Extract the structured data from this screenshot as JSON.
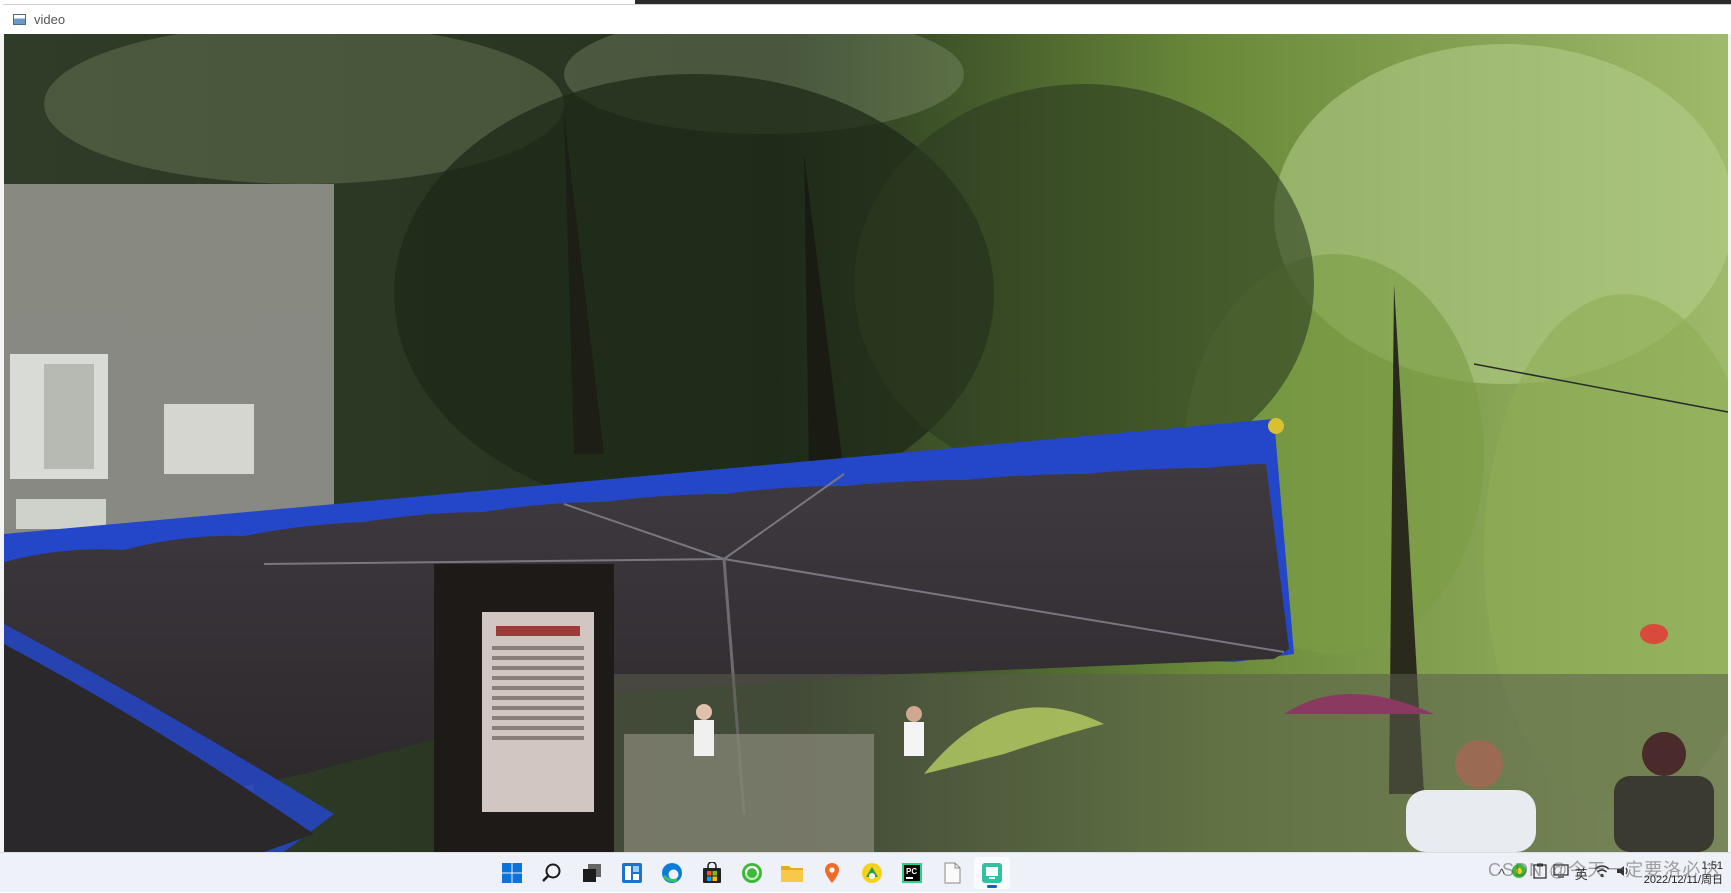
{
  "window": {
    "title": "video",
    "icon": "window-app-icon"
  },
  "video": {
    "scene": "video-frame-canvas"
  },
  "taskbar": {
    "apps": [
      {
        "name": "start-windows-icon",
        "active": false
      },
      {
        "name": "search-icon",
        "active": false
      },
      {
        "name": "task-view-icon",
        "active": false
      },
      {
        "name": "widgets-icon",
        "active": false
      },
      {
        "name": "edge-browser-icon",
        "active": false
      },
      {
        "name": "microsoft-store-icon",
        "active": false
      },
      {
        "name": "green-app-icon",
        "active": false
      },
      {
        "name": "file-explorer-icon",
        "active": false
      },
      {
        "name": "orange-map-app-icon",
        "active": false
      },
      {
        "name": "yellow-app-icon",
        "active": false
      },
      {
        "name": "pycharm-icon",
        "active": false
      },
      {
        "name": "notepad-icon",
        "active": false
      },
      {
        "name": "video-app-icon",
        "active": true
      }
    ],
    "tray": {
      "chevron": "^",
      "ime": "英",
      "clock_time": "1:51",
      "clock_date": "2022/12/11/周日"
    }
  },
  "watermark": "CSDN @今天一定要洛必达"
}
